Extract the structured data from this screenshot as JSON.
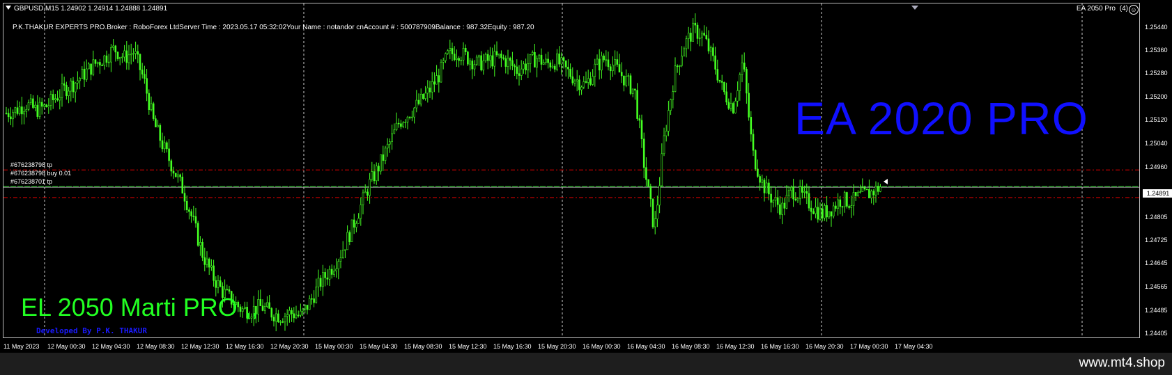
{
  "header": {
    "symbol_line": "GBPUSD,M15  1.24902 1.24914 1.24888 1.24891"
  },
  "info_line": "P.K.THAKUR EXPERTS PRO.Broker  : RoboForex LtdServer Time : 2023.05.17 05:32:02Your Name    : notandor cnAccount #   : 500787909Balance : 987.32Equity    : 987.20",
  "ea": {
    "name": "EA 2050 Pro",
    "count": "(4)",
    "smiley": "☺"
  },
  "overlay": {
    "big_blue": "EA 2020 PRO",
    "big_green": "EL 2050 Marti PRO ,,",
    "developer": "Developed By P.K. THAKUR"
  },
  "trades": [
    {
      "label": "#676238798 tp"
    },
    {
      "label": "#676238798 buy 0.01"
    },
    {
      "label": "#676238701 tp"
    }
  ],
  "chart_data": {
    "type": "candlestick",
    "symbol": "GBPUSD",
    "timeframe": "M15",
    "last_price": 1.24891,
    "price_ticks": [
      "1.25440",
      "1.25360",
      "1.25280",
      "1.25200",
      "1.25120",
      "1.25040",
      "1.24960",
      "1.24891",
      "1.24805",
      "1.24725",
      "1.24645",
      "1.24565",
      "1.24485",
      "1.24405"
    ],
    "time_ticks": [
      "11 May 2023",
      "12 May 00:30",
      "12 May 04:30",
      "12 May 08:30",
      "12 May 12:30",
      "12 May 16:30",
      "12 May 20:30",
      "15 May 00:30",
      "15 May 04:30",
      "15 May 08:30",
      "15 May 12:30",
      "15 May 16:30",
      "15 May 20:30",
      "16 May 00:30",
      "16 May 04:30",
      "16 May 08:30",
      "16 May 12:30",
      "16 May 16:30",
      "16 May 20:30",
      "17 May 00:30",
      "17 May 04:30"
    ],
    "tp_upper": 1.24945,
    "entry": 1.24891,
    "tp_lower": 1.24855,
    "ylim": [
      1.244,
      1.2548
    ],
    "path": [
      1.2513,
      1.2514,
      1.2516,
      1.2514,
      1.2515,
      1.2518,
      1.2521,
      1.2523,
      1.2526,
      1.2529,
      1.2531,
      1.2534,
      1.2531,
      1.2533,
      1.2524,
      1.251,
      1.2502,
      1.2495,
      1.2488,
      1.2478,
      1.2467,
      1.246,
      1.2455,
      1.2452,
      1.2449,
      1.2449,
      1.245,
      1.2448,
      1.2447,
      1.2448,
      1.2447,
      1.2452,
      1.2458,
      1.2462,
      1.2467,
      1.2474,
      1.2482,
      1.249,
      1.2496,
      1.2503,
      1.251,
      1.2513,
      1.2516,
      1.252,
      1.2525,
      1.2532,
      1.2533,
      1.2531,
      1.2529,
      1.253,
      1.2531,
      1.253,
      1.2527,
      1.2529,
      1.2531,
      1.2529,
      1.253,
      1.2527,
      1.2524,
      1.2522,
      1.2528,
      1.2531,
      1.2528,
      1.2524,
      1.252,
      1.2495,
      1.2475,
      1.2505,
      1.2525,
      1.2535,
      1.254,
      1.2538,
      1.253,
      1.252,
      1.2515,
      1.253,
      1.25,
      1.249,
      1.2485,
      1.2482,
      1.2488,
      1.2486,
      1.2483,
      1.248,
      1.2482,
      1.2485,
      1.2484,
      1.2486,
      1.2487,
      1.2489
    ]
  }
}
